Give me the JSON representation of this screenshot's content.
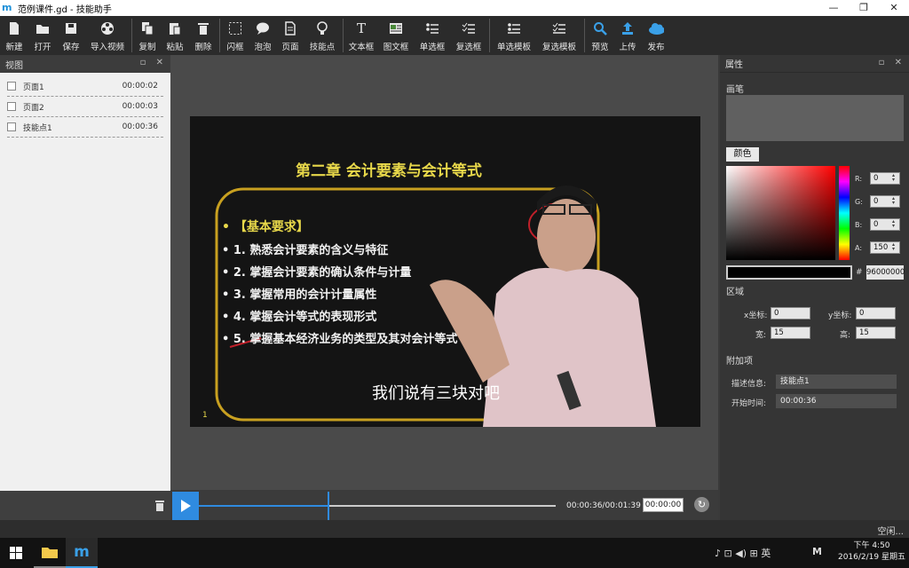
{
  "window": {
    "title": "范例课件.gd  - 技能助手",
    "logo": "m"
  },
  "winbtns": [
    "—",
    "❐",
    "✕"
  ],
  "toolbar": {
    "items": [
      {
        "label": "新建",
        "icon": "new-file-icon"
      },
      {
        "label": "打开",
        "icon": "folder-open-icon"
      },
      {
        "label": "保存",
        "icon": "save-icon"
      },
      {
        "label": "导入视频",
        "icon": "film-reel-icon"
      },
      {
        "label": "复制",
        "icon": "copy-icon"
      },
      {
        "label": "粘贴",
        "icon": "paste-icon"
      },
      {
        "label": "删除",
        "icon": "trash-icon"
      },
      {
        "label": "闪框",
        "icon": "dashed-box-icon"
      },
      {
        "label": "泡泡",
        "icon": "speech-bubble-icon"
      },
      {
        "label": "页面",
        "icon": "page-icon"
      },
      {
        "label": "技能点",
        "icon": "lightbulb-icon"
      },
      {
        "label": "文本框",
        "icon": "text-icon"
      },
      {
        "label": "图文框",
        "icon": "image-text-icon"
      },
      {
        "label": "单选框",
        "icon": "radio-list-icon"
      },
      {
        "label": "复选框",
        "icon": "checkbox-list-icon"
      },
      {
        "label": "单选模板",
        "icon": "radio-template-icon"
      },
      {
        "label": "复选模板",
        "icon": "checkbox-template-icon"
      },
      {
        "label": "预览",
        "icon": "search-icon"
      },
      {
        "label": "上传",
        "icon": "upload-icon"
      },
      {
        "label": "发布",
        "icon": "cloud-publish-icon"
      }
    ]
  },
  "left_panel": {
    "title": "视图",
    "controls": "▫ ✕",
    "items": [
      {
        "label": "页面1",
        "time": "00:00:02"
      },
      {
        "label": "页面2",
        "time": "00:00:03"
      },
      {
        "label": "技能点1",
        "time": "00:00:36"
      }
    ]
  },
  "video": {
    "title": "第二章 会计要素与会计等式",
    "heading": "• 【基本要求】",
    "lines": [
      "• 1.  熟悉会计要素的含义与特征",
      "• 2.  掌握会计要素的确认条件与计量",
      "• 3.  掌握常用的会计计量属性",
      "• 4.  掌握会计等式的表现形式",
      "• 5.  掌握基本经济业务的类型及其对会计等式"
    ],
    "subtitle": "我们说有三块对吧",
    "page_no": "1"
  },
  "timeline": {
    "time_display": "00:00:36/00:01:39",
    "time_input": "00:00:00",
    "progress": 0.363
  },
  "right_panel": {
    "title": "属性",
    "controls": "▫ ✕",
    "brush_label": "画笔",
    "color_tab": "颜色",
    "channels": [
      {
        "key": "R:",
        "value": "0"
      },
      {
        "key": "G:",
        "value": "0"
      },
      {
        "key": "B:",
        "value": "0"
      },
      {
        "key": "A:",
        "value": "150"
      }
    ],
    "hex_label": "#",
    "hex_value": "96000000",
    "region_label": "区域",
    "x_label": "x坐标:",
    "x_value": "0",
    "y_label": "y坐标:",
    "y_value": "0",
    "w_label": "宽:",
    "w_value": "15",
    "h_label": "高:",
    "h_value": "15",
    "extra_label": "附加项",
    "desc_label": "描述信息:",
    "desc_value": "技能点1",
    "start_label": "开始时间:",
    "start_value": "00:00:36"
  },
  "status": {
    "text": "空闲..."
  },
  "taskbar": {
    "tray": "♪ ⊡ ◀) ⊞ 英",
    "ime": "M",
    "time": "下午 4:50",
    "date": "2016/2/19 星期五"
  }
}
